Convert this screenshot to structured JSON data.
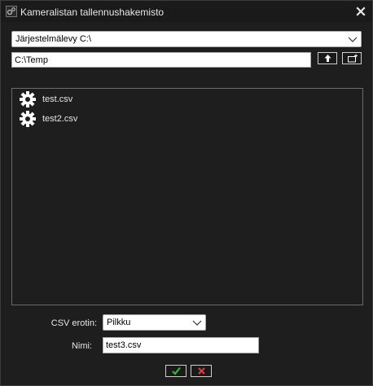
{
  "window": {
    "title": "Kameralistan tallennushakemisto"
  },
  "drive": {
    "selected": "Järjestelmälevy C:\\"
  },
  "path": {
    "value": "C:\\Temp"
  },
  "files": [
    {
      "name": "test.csv",
      "icon": "gear-icon"
    },
    {
      "name": "test2.csv",
      "icon": "gear-icon"
    }
  ],
  "form": {
    "separator_label": "CSV erotin:",
    "separator_value": "Pilkku",
    "name_label": "Nimi:",
    "name_value": "test3.csv"
  },
  "colors": {
    "ok": "#2fbf2f",
    "cancel": "#e23a3a",
    "background": "#1e1e1e"
  }
}
